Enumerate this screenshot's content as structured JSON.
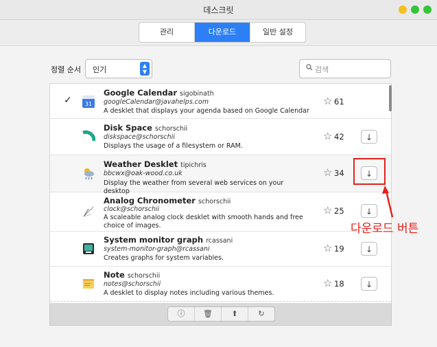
{
  "window": {
    "title": "데스크릿"
  },
  "tabs": [
    {
      "label": "관리",
      "active": false
    },
    {
      "label": "다운로드",
      "active": true
    },
    {
      "label": "일반 설정",
      "active": false
    }
  ],
  "sort": {
    "label": "정렬 순서",
    "value": "인기"
  },
  "search": {
    "placeholder": "검색"
  },
  "items": [
    {
      "name": "Google Calendar",
      "author": "sigobinath",
      "email": "googleCalendar@javahelps.com",
      "description": "A desklet that displays your agenda based on Google Calendar",
      "score": "61",
      "installed": true,
      "icon": "calendar-icon"
    },
    {
      "name": "Disk Space",
      "author": "schorschii",
      "email": "diskspace@schorschii",
      "description": "Displays the usage of a filesystem or RAM.",
      "score": "42",
      "installed": false,
      "icon": "disk-gauge-icon"
    },
    {
      "name": "Weather Desklet",
      "author": "tipichris",
      "email": "bbcwx@oak-wood.co.uk",
      "description": "Display the weather from several web services on your desktop",
      "score": "34",
      "installed": false,
      "icon": "weather-icon"
    },
    {
      "name": "Analog Chronometer",
      "author": "schorschii",
      "email": "clock@schorschii",
      "description": "A scaleable analog clock desklet with smooth hands and free choice of images.",
      "score": "25",
      "installed": false,
      "icon": "analog-clock-icon"
    },
    {
      "name": "System monitor graph",
      "author": "rcassani",
      "email": "system-monitor-graph@rcassani",
      "description": "Creates graphs for system variables.",
      "score": "19",
      "installed": false,
      "icon": "system-monitor-icon"
    },
    {
      "name": "Note",
      "author": "schorschii",
      "email": "notes@schorschii",
      "description": "A desklet to display notes including various themes.",
      "score": "18",
      "installed": false,
      "icon": "note-icon"
    }
  ],
  "annotation": {
    "text": "다운로드 버튼",
    "color": "#e3211c"
  },
  "colors": {
    "accent": "#2d7ff5"
  }
}
